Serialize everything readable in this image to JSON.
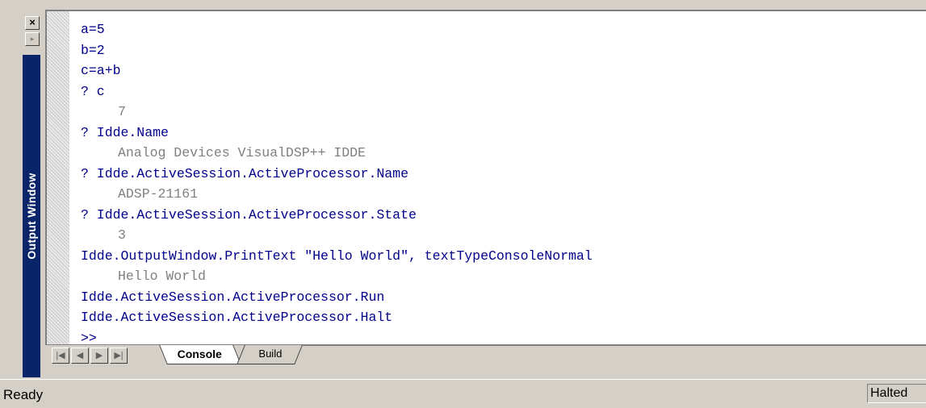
{
  "window": {
    "title": "Output Window"
  },
  "dock": {
    "close_icon": "close-icon",
    "maximize_icon": "maximize-icon"
  },
  "console": {
    "lines": [
      {
        "type": "cmd",
        "text": "a=5"
      },
      {
        "type": "cmd",
        "text": "b=2"
      },
      {
        "type": "cmd",
        "text": "c=a+b"
      },
      {
        "type": "cmd",
        "text": "? c"
      },
      {
        "type": "out",
        "text": "7"
      },
      {
        "type": "cmd",
        "text": "? Idde.Name"
      },
      {
        "type": "out",
        "text": "Analog Devices VisualDSP++ IDDE"
      },
      {
        "type": "cmd",
        "text": "? Idde.ActiveSession.ActiveProcessor.Name"
      },
      {
        "type": "out",
        "text": "ADSP-21161"
      },
      {
        "type": "cmd",
        "text": "? Idde.ActiveSession.ActiveProcessor.State"
      },
      {
        "type": "out",
        "text": "3"
      },
      {
        "type": "cmd",
        "text": "Idde.OutputWindow.PrintText \"Hello World\", textTypeConsoleNormal"
      },
      {
        "type": "out",
        "text": "Hello World"
      },
      {
        "type": "cmd",
        "text": "Idde.ActiveSession.ActiveProcessor.Run"
      },
      {
        "type": "cmd",
        "text": "Idde.ActiveSession.ActiveProcessor.Halt"
      },
      {
        "type": "prompt",
        "text": ">>"
      }
    ]
  },
  "tabs": {
    "items": [
      {
        "label": "Console",
        "active": true
      },
      {
        "label": "Build",
        "active": false
      }
    ],
    "nav_icons": [
      "first-tab-icon",
      "prev-tab-icon",
      "next-tab-icon",
      "last-tab-icon"
    ]
  },
  "statusbar": {
    "left_text": "Ready",
    "state_text": "Halted"
  },
  "colors": {
    "command": "#00008b",
    "output": "#808080",
    "titlebar": "#0a246a",
    "chrome": "#d4d0c8"
  }
}
